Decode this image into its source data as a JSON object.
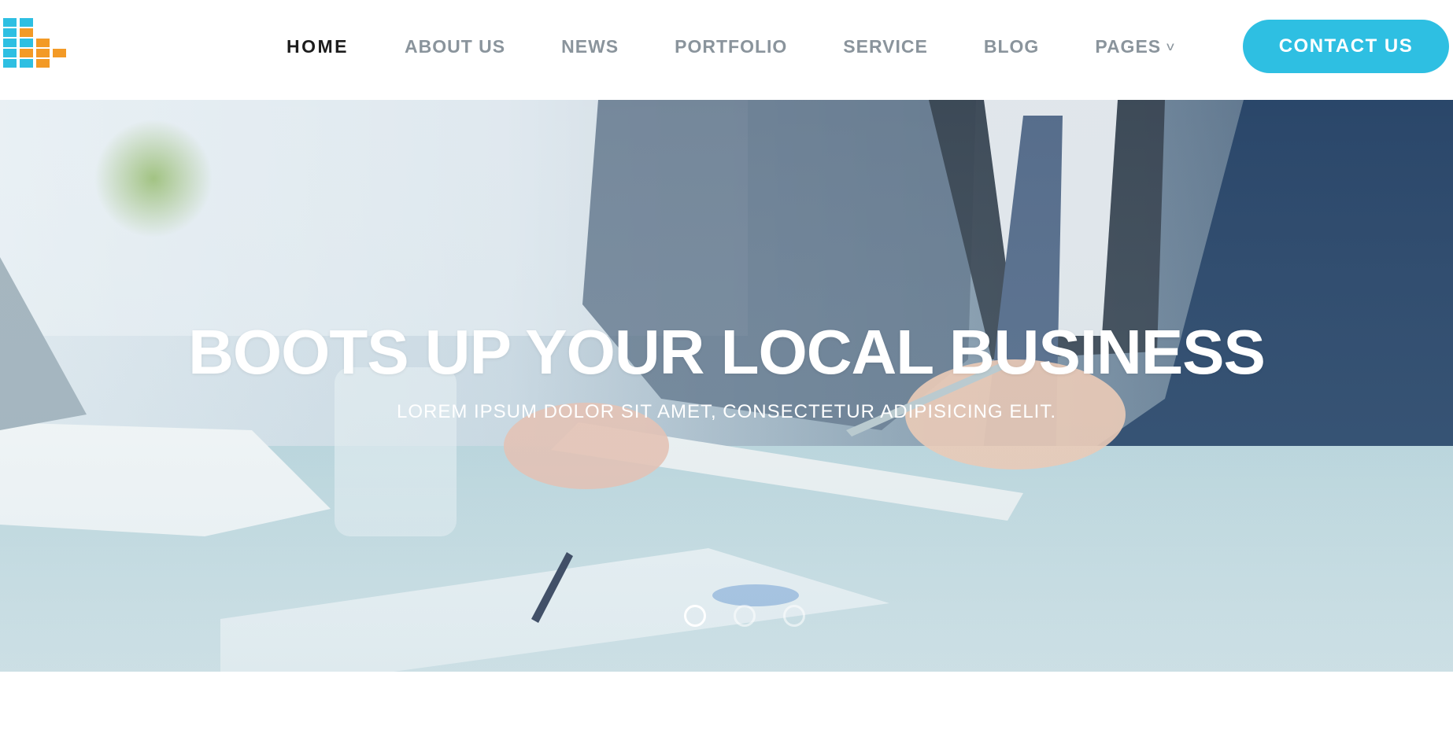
{
  "header": {
    "logo": {
      "icon": "stacked-blocks-logo",
      "colors": {
        "blue": "#2ebfe2",
        "orange": "#f39a26"
      }
    },
    "nav": [
      {
        "label": "HOME",
        "active": true
      },
      {
        "label": "ABOUT US",
        "active": false
      },
      {
        "label": "NEWS",
        "active": false
      },
      {
        "label": "PORTFOLIO",
        "active": false
      },
      {
        "label": "SERVICE",
        "active": false
      },
      {
        "label": "BLOG",
        "active": false
      },
      {
        "label": "PAGES",
        "active": false,
        "icon": "chevron-down-icon"
      }
    ],
    "contact_label": "CONTACT US",
    "accent": "#2ebfe2"
  },
  "hero": {
    "title": "BOOTS UP YOUR LOCAL BUSINESS",
    "subtitle": "LOREM IPSUM DOLOR SIT AMET, CONSECTETUR ADIPISICING ELIT.",
    "slides": {
      "count": 3,
      "active": 1
    }
  }
}
